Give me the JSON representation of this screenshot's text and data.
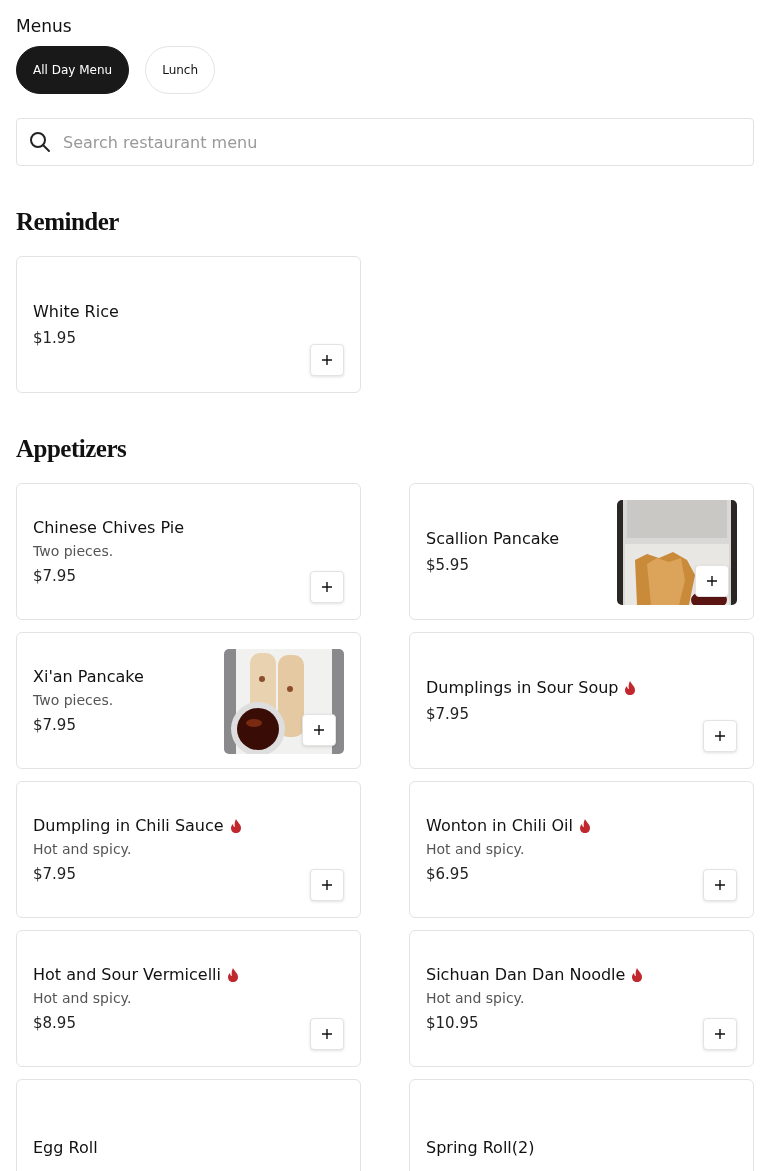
{
  "menus_label": "Menus",
  "tabs": [
    {
      "label": "All Day Menu",
      "selected": true
    },
    {
      "label": "Lunch",
      "selected": false
    }
  ],
  "search": {
    "placeholder": "Search restaurant menu"
  },
  "sections": [
    {
      "title": "Reminder",
      "items": [
        {
          "name": "White Rice",
          "price": "$1.95",
          "spicy": false
        }
      ]
    },
    {
      "title": "Appetizers",
      "items": [
        {
          "name": "Chinese Chives Pie",
          "description": "Two pieces.",
          "price": "$7.95",
          "spicy": false
        },
        {
          "name": "Scallion Pancake",
          "price": "$5.95",
          "spicy": false
        },
        {
          "name": "Xi'an Pancake",
          "description": "Two pieces.",
          "price": "$7.95",
          "spicy": false
        },
        {
          "name": "Dumplings in Sour Soup",
          "price": "$7.95",
          "spicy": true
        },
        {
          "name": "Dumpling in Chili Sauce",
          "description": "Hot and spicy.",
          "price": "$7.95",
          "spicy": true
        },
        {
          "name": "Wonton in Chili Oil",
          "description": "Hot and spicy.",
          "price": "$6.95",
          "spicy": true
        },
        {
          "name": "Hot and Sour Vermicelli",
          "description": "Hot and spicy.",
          "price": "$8.95",
          "spicy": true
        },
        {
          "name": "Sichuan Dan Dan Noodle",
          "description": "Hot and spicy.",
          "price": "$10.95",
          "spicy": true
        },
        {
          "name": "Egg Roll",
          "spicy": false
        },
        {
          "name": "Spring Roll(2)",
          "spicy": false
        }
      ]
    }
  ]
}
